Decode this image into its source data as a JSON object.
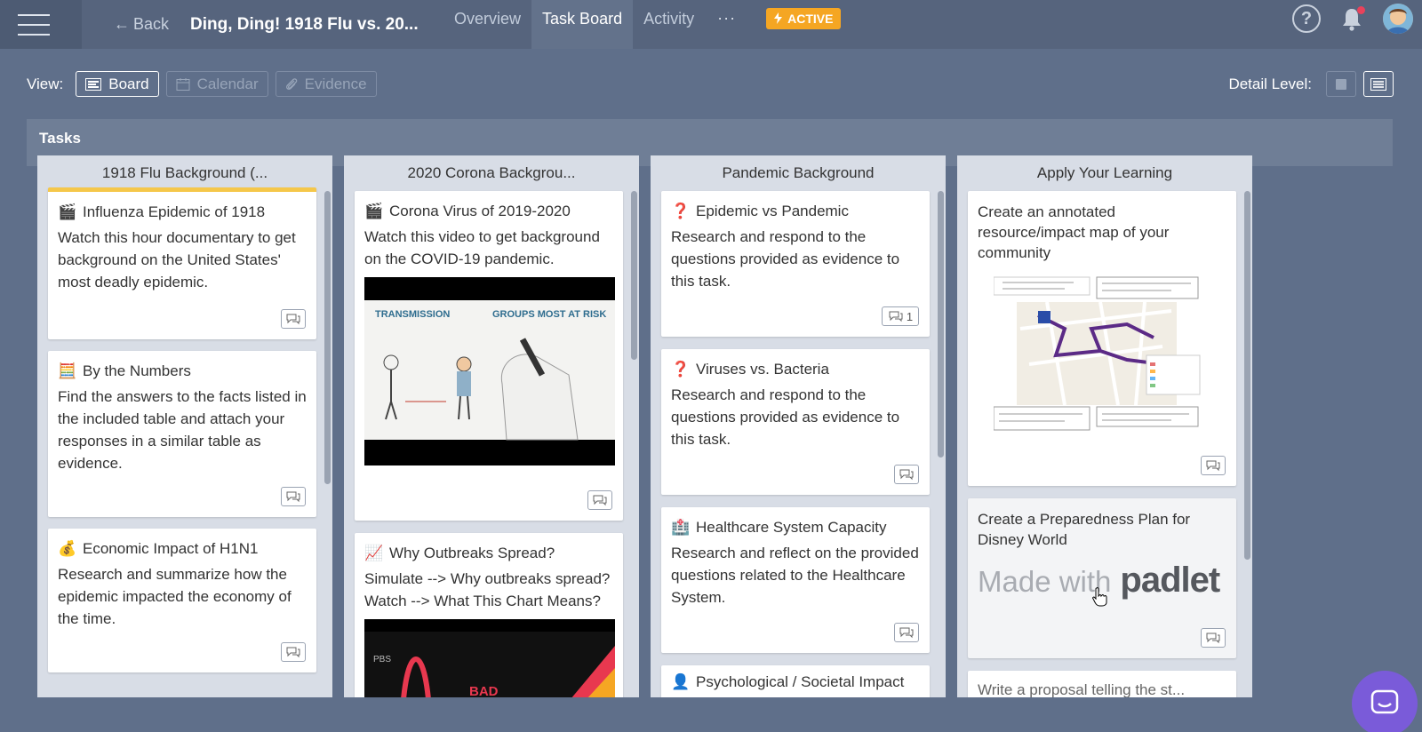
{
  "topbar": {
    "back_label": "Back",
    "project_title": "Ding, Ding! 1918 Flu vs. 20...",
    "tabs": [
      {
        "label": "Overview"
      },
      {
        "label": "Task Board"
      },
      {
        "label": "Activity"
      }
    ],
    "more_label": "···",
    "status_label": "ACTIVE",
    "status_color": "#f5a623"
  },
  "viewbar": {
    "label": "View:",
    "buttons": [
      {
        "label": "Board"
      },
      {
        "label": "Calendar"
      },
      {
        "label": "Evidence"
      }
    ],
    "detail_label": "Detail Level:"
  },
  "tasks": {
    "header": "Tasks",
    "columns": [
      {
        "title": "1918 Flu Background (...",
        "cards": [
          {
            "icon": "🎬",
            "title": "Influenza Epidemic of 1918",
            "desc": "Watch this hour documentary to get background on the United States' most deadly epidemic."
          },
          {
            "icon": "🧮",
            "title": "By the Numbers",
            "desc": "Find the answers to the facts listed in the included table and attach your responses in a similar table as evidence."
          },
          {
            "icon": "💰",
            "title": "Economic Impact of H1N1",
            "desc": "Research and summarize how the epidemic impacted the economy of the time."
          }
        ]
      },
      {
        "title": "2020 Corona Backgrou...",
        "cards": [
          {
            "icon": "🎬",
            "title": "Corona Virus of 2019-2020",
            "desc": "Watch this video to get background on the COVID-19 pandemic.",
            "thumb_labels": [
              "TRANSMISSION",
              "GROUPS MOST AT RISK"
            ]
          },
          {
            "icon": "📈",
            "title": "Why Outbreaks Spread?",
            "desc": "Simulate --> Why outbreaks spread? Watch --> What This Chart Means?",
            "thumb_labels": [
              "PBS",
              "BAD"
            ]
          }
        ]
      },
      {
        "title": "Pandemic Background",
        "cards": [
          {
            "icon": "❓",
            "title": "Epidemic vs Pandemic",
            "desc": "Research and respond to the questions provided as evidence to this task.",
            "comments": "1"
          },
          {
            "icon": "❓",
            "title": "Viruses vs. Bacteria",
            "desc": "Research and respond to the questions provided as evidence to this task."
          },
          {
            "icon": "🏥",
            "title": "Healthcare System Capacity",
            "desc": "Research and reflect on the provided questions related to the Healthcare System."
          },
          {
            "icon": "👤",
            "title": "Psychological / Societal Impact"
          }
        ]
      },
      {
        "title": "Apply Your Learning",
        "cards": [
          {
            "desc": "Create an annotated resource/impact map of your community"
          },
          {
            "desc": "Create a Preparedness Plan for Disney World",
            "padlet_made": "Made with",
            "padlet_brand": "padlet"
          },
          {
            "desc": "Write a proposal telling the st..."
          }
        ]
      }
    ]
  },
  "colors": {
    "background": "#5f6f8a",
    "topbar": "#56647d",
    "accent": "#f5a623",
    "chat": "#7a5bd9"
  }
}
